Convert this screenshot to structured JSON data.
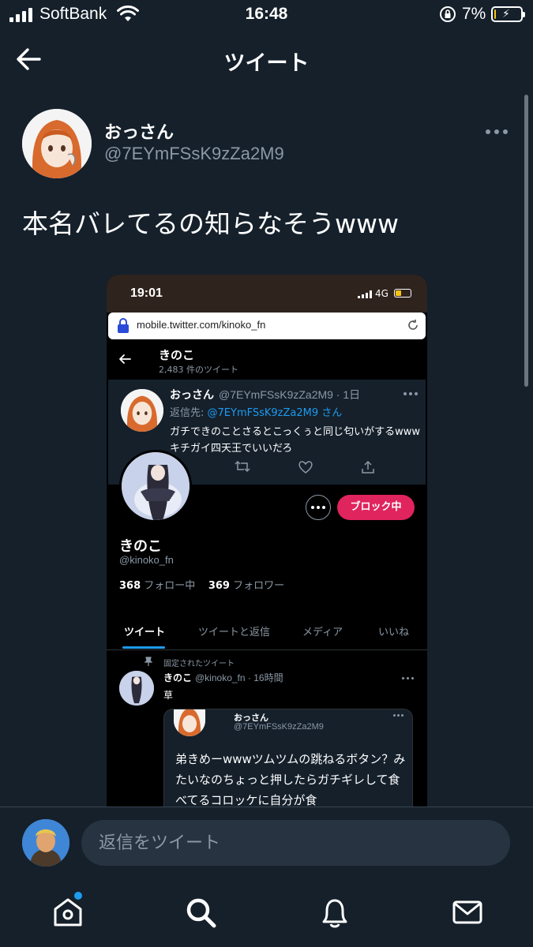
{
  "status_bar": {
    "carrier": "SoftBank",
    "time": "16:48",
    "battery_percent": "7%",
    "battery_level": 0.07
  },
  "header": {
    "title": "ツイート",
    "back_icon": "arrow-left-icon"
  },
  "tweet": {
    "author_name": "おっさん",
    "author_handle": "@7EYmFSsK9zZa2M9",
    "text": "本名バレてるの知らなそうwww",
    "more_icon": "ellipsis-icon"
  },
  "embedded_screenshot": {
    "status_time": "19:01",
    "network": "4G",
    "url": "mobile.twitter.com/kinoko_fn",
    "nav": {
      "name": "きのこ",
      "tweet_count": "2,483 件のツイート"
    },
    "reply_tweet": {
      "author_name": "おっさん",
      "handle_time": "@7EYmFSsK9zZa2M9 · 1日",
      "reply_prefix": "返信先: ",
      "reply_target": "@7EYmFSsK9zZa2M9",
      "reply_suffix": " さん",
      "text": "ガチできのことさるとこっくぅと同じ匂いがするwwwキチガイ四天王でいいだろ"
    },
    "profile": {
      "block_label": "ブロック中",
      "name": "きのこ",
      "handle": "@kinoko_fn",
      "following_count": "368",
      "following_label": "フォロー中",
      "followers_count": "369",
      "followers_label": "フォロワー"
    },
    "tabs": [
      "ツイート",
      "ツイートと返信",
      "メディア",
      "いいね"
    ],
    "pinned_label": "固定されたツイート",
    "pinned_tweet": {
      "author_name": "きのこ",
      "handle_time": "@kinoko_fn · 16時間",
      "text": "草",
      "quote": {
        "author_name": "おっさん",
        "author_handle": "@7EYmFSsK9zZa2M9",
        "text": "弟きめーwwwツムツムの跳ねるボタン？みたいなのちょっと押したらガチギレして食べてるコロッケに自分が食"
      }
    }
  },
  "reply_bar": {
    "placeholder": "返信をツイート"
  },
  "bottom_nav": {
    "items": [
      "home-icon",
      "search-icon",
      "notifications-icon",
      "messages-icon"
    ],
    "accent": "#1d9bf0"
  },
  "colors": {
    "background": "#15202b",
    "accent": "#1d9bf0",
    "block": "#e0245e",
    "secondary_text": "#8b98a5"
  }
}
